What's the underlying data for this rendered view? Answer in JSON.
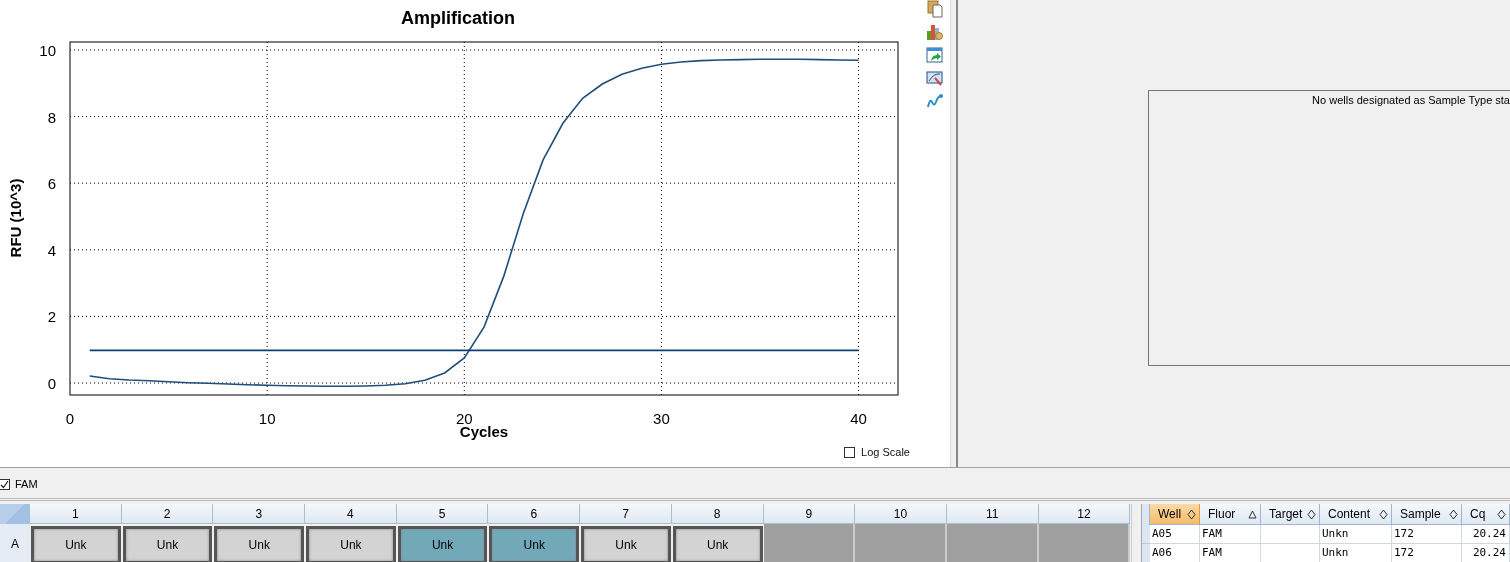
{
  "chart_panel": {
    "chart_data": {
      "type": "line",
      "title": "Amplification",
      "xlabel": "Cycles",
      "ylabel": "RFU (10^3)",
      "x": [
        1,
        2,
        3,
        4,
        5,
        6,
        7,
        8,
        9,
        10,
        11,
        12,
        13,
        14,
        15,
        16,
        17,
        18,
        19,
        20,
        21,
        22,
        23,
        24,
        25,
        26,
        27,
        28,
        29,
        30,
        31,
        32,
        33,
        34,
        35,
        36,
        37,
        38,
        39,
        40
      ],
      "series": [
        {
          "color": "#1f4e79",
          "values": [
            0.21,
            0.13,
            0.09,
            0.07,
            0.04,
            0.01,
            -0.01,
            -0.03,
            -0.05,
            -0.07,
            -0.08,
            -0.09,
            -0.1,
            -0.1,
            -0.09,
            -0.07,
            -0.02,
            0.08,
            0.3,
            0.75,
            1.68,
            3.2,
            5.1,
            6.7,
            7.8,
            8.55,
            8.98,
            9.27,
            9.45,
            9.57,
            9.64,
            9.68,
            9.7,
            9.71,
            9.72,
            9.72,
            9.72,
            9.71,
            9.7,
            9.69
          ]
        },
        {
          "color": "#0f3f6e",
          "values": [
            0.98,
            0.98,
            0.98,
            0.98,
            0.98,
            0.98,
            0.98,
            0.98,
            0.98,
            0.98,
            0.98,
            0.98,
            0.98,
            0.98,
            0.98,
            0.98,
            0.98,
            0.98,
            0.98,
            0.98,
            0.98,
            0.98,
            0.98,
            0.98,
            0.98,
            0.98,
            0.98,
            0.98,
            0.98,
            0.98,
            0.98,
            0.98,
            0.98,
            0.98,
            0.98,
            0.98,
            0.98,
            0.98,
            0.98,
            0.98
          ]
        }
      ],
      "grid": true,
      "xlim": [
        0,
        42
      ],
      "ylim": [
        -0.36,
        10.24
      ],
      "xticks": [
        0,
        10,
        20,
        30,
        40
      ],
      "yticks": [
        0,
        2,
        4,
        6,
        8,
        10
      ]
    },
    "log_scale": {
      "label": "Log Scale",
      "checked": false
    }
  },
  "toolbar": [
    {
      "kind": "copy"
    },
    {
      "kind": "chart-settings"
    },
    {
      "kind": "export"
    },
    {
      "kind": "chart-edit"
    },
    {
      "kind": "curve"
    }
  ],
  "standard_curve_panel": {
    "message": "No wells designated as Sample Type sta"
  },
  "fluor_filter": {
    "label": "FAM",
    "checked": true
  },
  "plate": {
    "columns": [
      "1",
      "2",
      "3",
      "4",
      "5",
      "6",
      "7",
      "8",
      "9",
      "10",
      "11",
      "12"
    ],
    "rows": [
      {
        "label": "A",
        "wells": [
          {
            "kind": "sample",
            "label": "Unk",
            "selected": false
          },
          {
            "kind": "sample",
            "label": "Unk",
            "selected": false
          },
          {
            "kind": "sample",
            "label": "Unk",
            "selected": false
          },
          {
            "kind": "sample",
            "label": "Unk",
            "selected": false
          },
          {
            "kind": "sample",
            "label": "Unk",
            "selected": true
          },
          {
            "kind": "sample",
            "label": "Unk",
            "selected": true
          },
          {
            "kind": "sample",
            "label": "Unk",
            "selected": false
          },
          {
            "kind": "sample",
            "label": "Unk",
            "selected": false
          },
          {
            "kind": "empty"
          },
          {
            "kind": "empty"
          },
          {
            "kind": "empty"
          },
          {
            "kind": "empty"
          }
        ]
      }
    ]
  },
  "results_table": {
    "columns": [
      {
        "label": "Well",
        "sorted": false,
        "highlighted": true
      },
      {
        "label": "Fluor",
        "sorted": true,
        "highlighted": false
      },
      {
        "label": "Target",
        "sorted": false,
        "highlighted": false
      },
      {
        "label": "Content",
        "sorted": false,
        "highlighted": false
      },
      {
        "label": "Sample",
        "sorted": false,
        "highlighted": false
      },
      {
        "label": "Cq",
        "sorted": false,
        "highlighted": false
      }
    ],
    "rows": [
      [
        "A05",
        "FAM",
        "",
        "Unkn",
        "172",
        "20.24"
      ],
      [
        "A06",
        "FAM",
        "",
        "Unkn",
        "172",
        "20.24"
      ]
    ]
  }
}
